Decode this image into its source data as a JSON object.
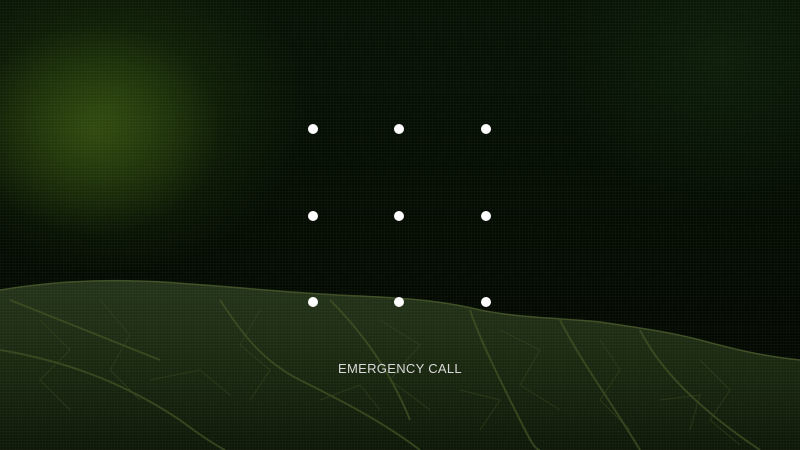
{
  "lockscreen": {
    "wallpaper": "green-leaf-wallpaper",
    "pattern_dots": [
      {
        "id": "dot-1"
      },
      {
        "id": "dot-2"
      },
      {
        "id": "dot-3"
      },
      {
        "id": "dot-4"
      },
      {
        "id": "dot-5"
      },
      {
        "id": "dot-6"
      },
      {
        "id": "dot-7"
      },
      {
        "id": "dot-8"
      },
      {
        "id": "dot-9"
      }
    ],
    "emergency_call_label": "EMERGENCY CALL"
  },
  "colors": {
    "background": "#040b02",
    "dot": "#ffffff",
    "text": "#d8d8d8",
    "leaf": "#1c2a10"
  }
}
